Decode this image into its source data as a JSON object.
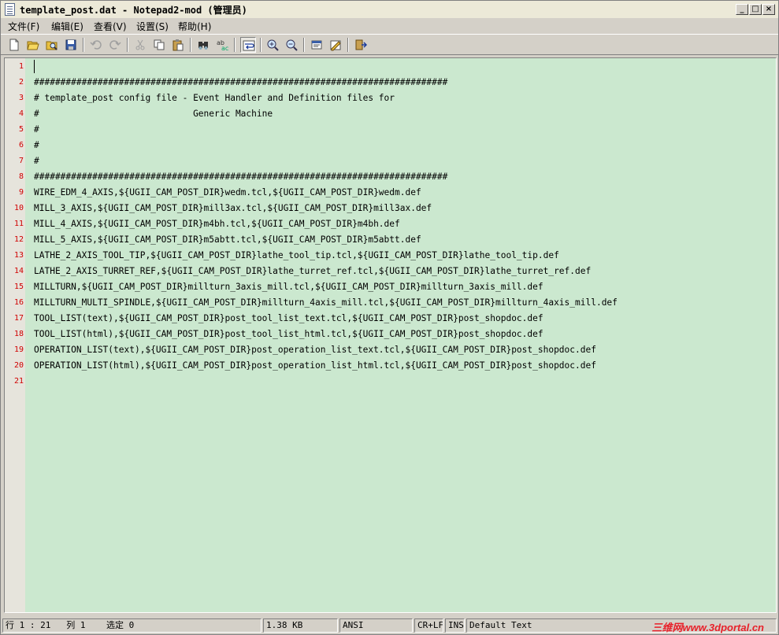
{
  "window": {
    "title": "template_post.dat - Notepad2-mod (管理员)",
    "controls": {
      "minimize": "_",
      "maximize": "□",
      "close": "×"
    }
  },
  "menu": [
    {
      "label": "文件(F)"
    },
    {
      "label": "编辑(E)"
    },
    {
      "label": "查看(V)"
    },
    {
      "label": "设置(S)"
    },
    {
      "label": "帮助(H)"
    }
  ],
  "toolbar": {
    "buttons": [
      "new-icon",
      "open-icon",
      "browse-icon",
      "save-icon",
      "undo-icon",
      "redo-icon",
      "cut-icon",
      "copy-icon",
      "paste-icon",
      "find-icon",
      "replace-icon",
      "word-wrap-icon",
      "zoom-in-icon",
      "zoom-out-icon",
      "select-scheme-icon",
      "customize-scheme-icon",
      "exit-icon"
    ]
  },
  "editor": {
    "line_numbers": [
      "1",
      "2",
      "3",
      "4",
      "5",
      "6",
      "7",
      "8",
      "9",
      "10",
      "11",
      "12",
      "13",
      "14",
      "15",
      "16",
      "17",
      "18",
      "19",
      "20",
      "21"
    ],
    "lines": [
      "",
      "##############################################################################",
      "# template_post config file - Event Handler and Definition files for",
      "#                             Generic Machine",
      "#",
      "#",
      "#",
      "##############################################################################",
      "WIRE_EDM_4_AXIS,${UGII_CAM_POST_DIR}wedm.tcl,${UGII_CAM_POST_DIR}wedm.def",
      "MILL_3_AXIS,${UGII_CAM_POST_DIR}mill3ax.tcl,${UGII_CAM_POST_DIR}mill3ax.def",
      "MILL_4_AXIS,${UGII_CAM_POST_DIR}m4bh.tcl,${UGII_CAM_POST_DIR}m4bh.def",
      "MILL_5_AXIS,${UGII_CAM_POST_DIR}m5abtt.tcl,${UGII_CAM_POST_DIR}m5abtt.def",
      "LATHE_2_AXIS_TOOL_TIP,${UGII_CAM_POST_DIR}lathe_tool_tip.tcl,${UGII_CAM_POST_DIR}lathe_tool_tip.def",
      "LATHE_2_AXIS_TURRET_REF,${UGII_CAM_POST_DIR}lathe_turret_ref.tcl,${UGII_CAM_POST_DIR}lathe_turret_ref.def",
      "MILLTURN,${UGII_CAM_POST_DIR}millturn_3axis_mill.tcl,${UGII_CAM_POST_DIR}millturn_3axis_mill.def",
      "MILLTURN_MULTI_SPINDLE,${UGII_CAM_POST_DIR}millturn_4axis_mill.tcl,${UGII_CAM_POST_DIR}millturn_4axis_mill.def",
      "TOOL_LIST(text),${UGII_CAM_POST_DIR}post_tool_list_text.tcl,${UGII_CAM_POST_DIR}post_shopdoc.def",
      "TOOL_LIST(html),${UGII_CAM_POST_DIR}post_tool_list_html.tcl,${UGII_CAM_POST_DIR}post_shopdoc.def",
      "OPERATION_LIST(text),${UGII_CAM_POST_DIR}post_operation_list_text.tcl,${UGII_CAM_POST_DIR}post_shopdoc.def",
      "OPERATION_LIST(html),${UGII_CAM_POST_DIR}post_operation_list_html.tcl,${UGII_CAM_POST_DIR}post_shopdoc.def",
      ""
    ],
    "colors": {
      "background": "#cbe8cf",
      "line_number": "#d00000"
    }
  },
  "status": {
    "position": "行 1 : 21   列 1    选定 0",
    "size": "1.38 KB",
    "encoding": "ANSI",
    "eol": "CR+LF",
    "mode": "INS",
    "scheme": "Default Text",
    "watermark": "三维网www.3dportal.cn"
  }
}
